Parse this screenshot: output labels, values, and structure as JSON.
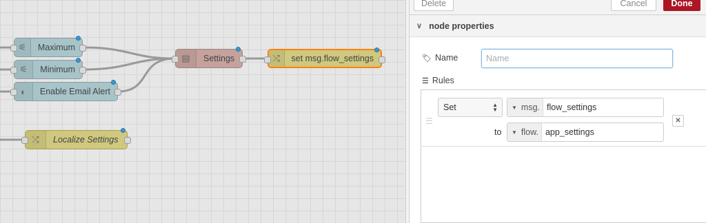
{
  "canvas": {
    "nodes": {
      "maximum": {
        "label": "Maximum",
        "icon": "sliders-icon"
      },
      "minimum": {
        "label": "Minimum",
        "icon": "sliders-icon"
      },
      "enable_email": {
        "label": "Enable Email Alert",
        "icon": "toggle-icon"
      },
      "settings": {
        "label": "Settings",
        "icon": "template-icon"
      },
      "set_flow": {
        "label": "set msg.flow_settings",
        "icon": "shuffle-icon"
      },
      "localize": {
        "label": "Localize Settings",
        "icon": "shuffle-icon"
      }
    }
  },
  "tray": {
    "buttons": {
      "delete": "Delete",
      "cancel": "Cancel",
      "done": "Done"
    },
    "section_title": "node properties",
    "name_label": "Name",
    "name_placeholder": "Name",
    "name_value": "",
    "rules_label": "Rules",
    "rule": {
      "action": "Set",
      "target_type": "msg.",
      "target_value": "flow_settings",
      "to_label": "to",
      "source_type": "flow.",
      "source_value": "app_settings"
    }
  },
  "colors": {
    "done_button": "#ad1625",
    "selected_outline": "#ff7f0e",
    "change_node": "#cfc87e"
  }
}
